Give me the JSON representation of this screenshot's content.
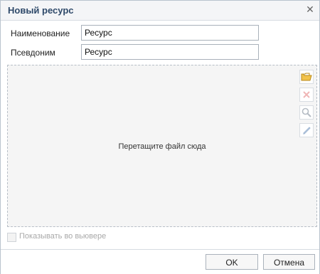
{
  "dialog": {
    "title": "Новый ресурс",
    "close_icon": "close-icon"
  },
  "form": {
    "name_label": "Наименование",
    "name_value": "Ресурс",
    "alias_label": "Псевдоним",
    "alias_value": "Ресурс"
  },
  "dropzone": {
    "hint": "Перетащите файл сюда",
    "tools": [
      {
        "icon": "folder-open-icon",
        "enabled": true
      },
      {
        "icon": "delete-icon",
        "enabled": false
      },
      {
        "icon": "zoom-icon",
        "enabled": false
      },
      {
        "icon": "edit-icon",
        "enabled": false
      }
    ]
  },
  "options": {
    "show_in_viewer_label": "Показывать во вьювере",
    "show_in_viewer_checked": false,
    "enabled": false
  },
  "buttons": {
    "ok_label": "OK",
    "cancel_label": "Отмена"
  }
}
